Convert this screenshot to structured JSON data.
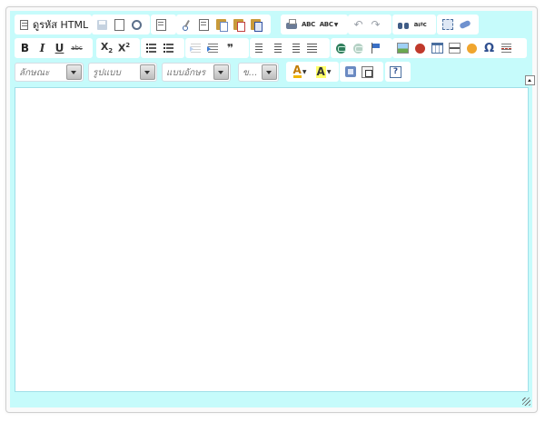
{
  "editor": {
    "source_label": "ดูรหัส HTML",
    "bold": "B",
    "italic": "I",
    "underline": "U",
    "strike": "abc",
    "subscript": "X",
    "subscript_digit": "2",
    "superscript": "X",
    "superscript_digit": "2",
    "quote": "❞",
    "omega": "Ω",
    "font_color": "A",
    "bg_color": "A",
    "help": "?"
  },
  "combos": {
    "styles": "ลักษณะ",
    "format": "รูปแบบ",
    "font": "แบบอักษร",
    "size": "ข..."
  },
  "content": {
    "value": ""
  }
}
